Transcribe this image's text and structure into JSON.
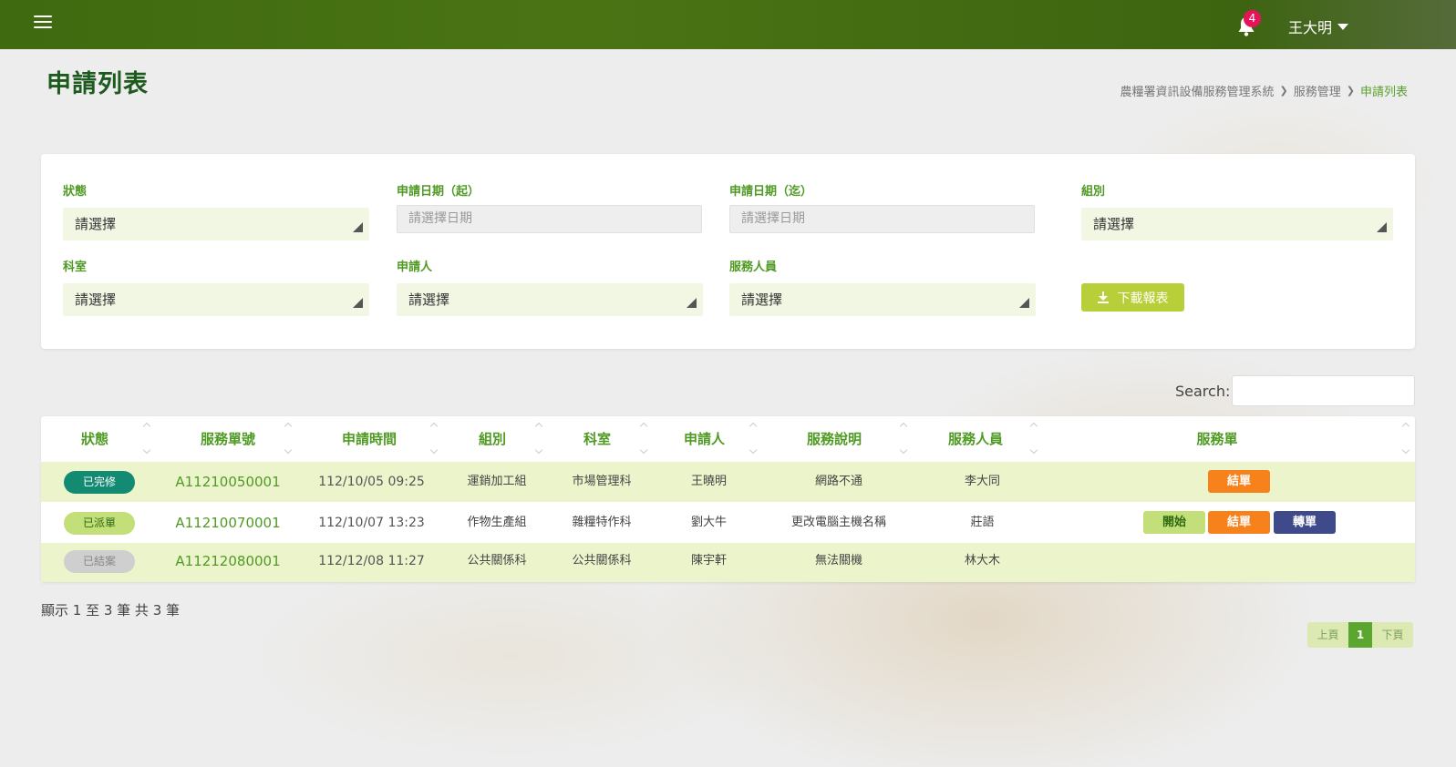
{
  "header": {
    "notifications_count": "4",
    "user_name": "王大明"
  },
  "page": {
    "title": "申請列表",
    "breadcrumb": [
      "農糧署資訊設備服務管理系統",
      "服務管理",
      "申請列表"
    ]
  },
  "filters": {
    "status_label": "狀態",
    "status_value": "請選擇",
    "date_from_label": "申請日期（起）",
    "date_from_placeholder": "請選擇日期",
    "date_to_label": "申請日期（迄）",
    "date_to_placeholder": "請選擇日期",
    "group_label": "組別",
    "group_value": "請選擇",
    "section_label": "科室",
    "section_value": "請選擇",
    "applicant_label": "申請人",
    "applicant_value": "請選擇",
    "staff_label": "服務人員",
    "staff_value": "請選擇",
    "download_label": "下載報表"
  },
  "search": {
    "label": "Search:"
  },
  "table": {
    "columns": [
      "狀態",
      "服務單號",
      "申請時間",
      "組別",
      "科室",
      "申請人",
      "服務說明",
      "服務人員",
      "服務單"
    ],
    "rows": [
      {
        "status": "已完修",
        "status_color": "#138a72",
        "status_text_color": "#ffffff",
        "ticket": "A11210050001",
        "time": "112/10/05 09:25",
        "group": "運銷加工組",
        "section": "市場管理科",
        "applicant": "王曉明",
        "desc": "網路不通",
        "staff": "李大同",
        "actions": [
          "結單"
        ]
      },
      {
        "status": "已派單",
        "status_color": "#c3df7a",
        "status_text_color": "#2f6a12",
        "ticket": "A11210070001",
        "time": "112/10/07 13:23",
        "group": "作物生產組",
        "section": "雜糧特作科",
        "applicant": "劉大牛",
        "desc": "更改電腦主機名稱",
        "staff": "莊語",
        "actions": [
          "開始",
          "結單",
          "轉單"
        ]
      },
      {
        "status": "已結案",
        "status_color": "#cfcfcf",
        "status_text_color": "#888888",
        "ticket": "A11212080001",
        "time": "112/12/08 11:27",
        "group": "公共關係科",
        "section": "公共關係科",
        "applicant": "陳宇軒",
        "desc": "無法關機",
        "staff": "林大木",
        "actions": []
      }
    ]
  },
  "footer": {
    "info": "顯示 1 至 3 筆 共 3 筆",
    "prev_label": "上頁",
    "page_num": "1",
    "next_label": "下頁"
  },
  "colors": {
    "topbar": "#4a7414",
    "accent_green": "#4f9a23",
    "btn_close": "#f7821b",
    "btn_start": "#c3df7a",
    "btn_transfer": "#3e4a8a",
    "download_btn": "#b9cf3a"
  }
}
